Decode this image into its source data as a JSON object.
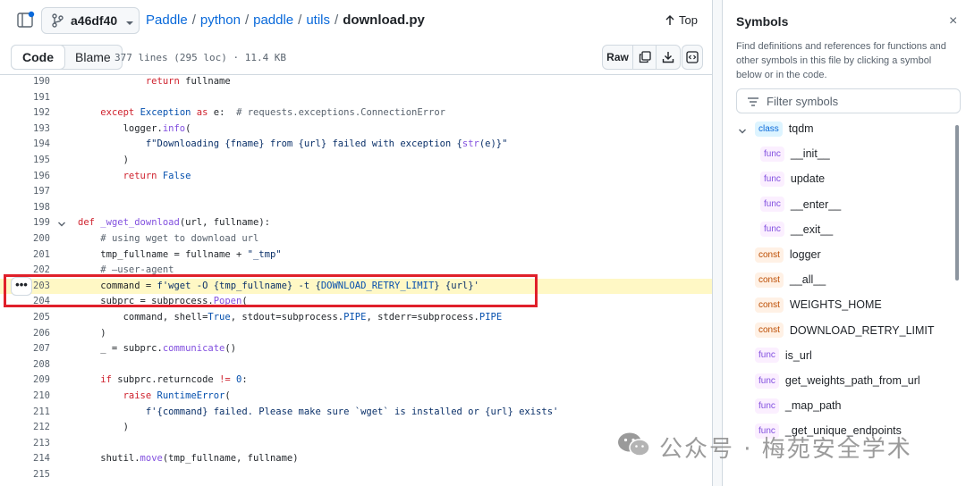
{
  "header": {
    "branch": "a46df40",
    "breadcrumb": [
      "Paddle",
      "python",
      "paddle",
      "utils"
    ],
    "file": "download.py",
    "top_label": "Top"
  },
  "toolbar": {
    "tabs": [
      "Code",
      "Blame"
    ],
    "meta": "377 lines (295 loc) · 11.4 KB",
    "raw_label": "Raw"
  },
  "code": {
    "highlight_line": 203,
    "lines": [
      {
        "n": "190",
        "html": "            <span class=\"tok-k\">return</span> fullname"
      },
      {
        "n": "191",
        "html": ""
      },
      {
        "n": "192",
        "html": "    <span class=\"tok-k\">except</span> <span class=\"tok-n\">Exception</span> <span class=\"tok-k\">as</span> e:  <span class=\"tok-c\"># requests.exceptions.ConnectionError</span>"
      },
      {
        "n": "193",
        "html": "        logger.<span class=\"tok-f\">info</span>("
      },
      {
        "n": "194",
        "html": "            <span class=\"tok-s\">f\"Downloading {fname} from {url} failed with exception {<span class=\"tok-f\">str</span>(e)}\"</span>"
      },
      {
        "n": "195",
        "html": "        )"
      },
      {
        "n": "196",
        "html": "        <span class=\"tok-k\">return</span> <span class=\"tok-n\">False</span>"
      },
      {
        "n": "197",
        "html": ""
      },
      {
        "n": "198",
        "html": ""
      },
      {
        "n": "199",
        "html": "<span class=\"tok-k\">def</span> <span class=\"tok-f\">_wget_download</span>(url, fullname):",
        "fold": true
      },
      {
        "n": "200",
        "html": "    <span class=\"tok-c\"># using wget to download url</span>"
      },
      {
        "n": "201",
        "html": "    tmp_fullname = fullname + <span class=\"tok-s\">\"_tmp\"</span>"
      },
      {
        "n": "202",
        "html": "    <span class=\"tok-c\"># –user-agent</span>"
      },
      {
        "n": "203",
        "html": "    command = <span class=\"tok-s\">f'wget -O {tmp_fullname} -t {<span class=\"tok-n\">DOWNLOAD_RETRY_LIMIT</span>} {url}'</span>",
        "dots": true
      },
      {
        "n": "204",
        "html": "    subprc = subprocess.<span class=\"tok-f\">Popen</span>("
      },
      {
        "n": "205",
        "html": "        command, shell=<span class=\"tok-n\">True</span>, stdout=subprocess.<span class=\"tok-n\">PIPE</span>, stderr=subprocess.<span class=\"tok-n\">PIPE</span>"
      },
      {
        "n": "206",
        "html": "    )"
      },
      {
        "n": "207",
        "html": "    _ = subprc.<span class=\"tok-f\">communicate</span>()"
      },
      {
        "n": "208",
        "html": ""
      },
      {
        "n": "209",
        "html": "    <span class=\"tok-k\">if</span> subprc.returncode <span class=\"tok-k\">!=</span> <span class=\"tok-n\">0</span>:"
      },
      {
        "n": "210",
        "html": "        <span class=\"tok-k\">raise</span> <span class=\"tok-n\">RuntimeError</span>("
      },
      {
        "n": "211",
        "html": "            <span class=\"tok-s\">f'{command} failed. Please make sure `wget` is installed or {url} exists'</span>"
      },
      {
        "n": "212",
        "html": "        )"
      },
      {
        "n": "213",
        "html": ""
      },
      {
        "n": "214",
        "html": "    shutil.<span class=\"tok-f\">move</span>(tmp_fullname, fullname)"
      },
      {
        "n": "215",
        "html": ""
      }
    ]
  },
  "symbols": {
    "title": "Symbols",
    "close_glyph": "×",
    "description": "Find definitions and references for functions and other symbols in this file by clicking a symbol below or in the code.",
    "filter_placeholder": "Filter symbols",
    "items": [
      {
        "kind": "class",
        "name": "tqdm",
        "indent": 1
      },
      {
        "kind": "func",
        "name": "__init__",
        "indent": 2
      },
      {
        "kind": "func",
        "name": "update",
        "indent": 2
      },
      {
        "kind": "func",
        "name": "__enter__",
        "indent": 2
      },
      {
        "kind": "func",
        "name": "__exit__",
        "indent": 2
      },
      {
        "kind": "const",
        "name": "logger",
        "indent": 1
      },
      {
        "kind": "const",
        "name": "__all__",
        "indent": 1
      },
      {
        "kind": "const",
        "name": "WEIGHTS_HOME",
        "indent": 1
      },
      {
        "kind": "const",
        "name": "DOWNLOAD_RETRY_LIMIT",
        "indent": 1
      },
      {
        "kind": "func",
        "name": "is_url",
        "indent": 1
      },
      {
        "kind": "func",
        "name": "get_weights_path_from_url",
        "indent": 1
      },
      {
        "kind": "func",
        "name": "_map_path",
        "indent": 1
      },
      {
        "kind": "func",
        "name": "_get_unique_endpoints",
        "indent": 1
      }
    ]
  },
  "watermark": {
    "text": "公众号 · 梅苑安全学术"
  },
  "colors": {
    "accent": "#0969da",
    "highlight": "#fff8c5",
    "annotation": "#e0202a"
  }
}
